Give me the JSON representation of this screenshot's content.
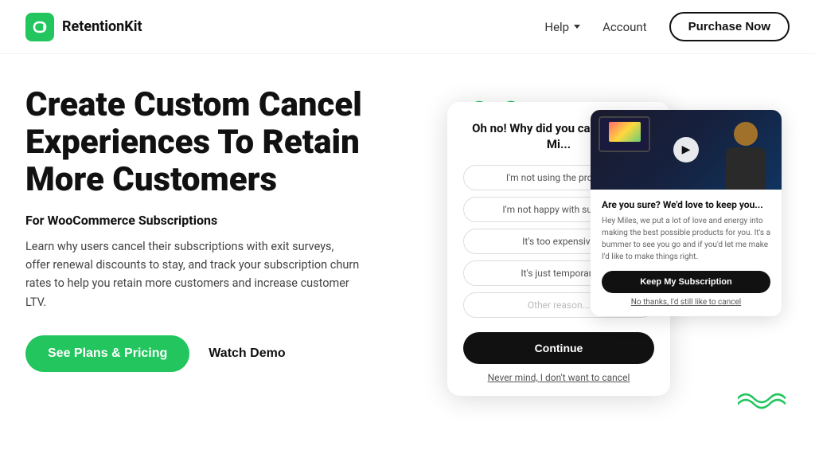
{
  "header": {
    "logo_text": "RetentionKit",
    "nav": {
      "help_label": "Help",
      "account_label": "Account",
      "purchase_label": "Purchase Now"
    }
  },
  "hero": {
    "title": "Create Custom Cancel Experiences To Retain More Customers",
    "subtitle": "For WooCommerce Subscriptions",
    "description": "Learn why users cancel their subscriptions with exit surveys, offer renewal discounts to stay, and track your subscription churn rates to help you retain more customers and increase customer LTV.",
    "cta_primary": "See Plans & Pricing",
    "cta_secondary": "Watch Demo"
  },
  "modal": {
    "header": "Oh no! Why did you cancel today Mi...",
    "options": [
      "I'm not using the product",
      "I'm not happy with support",
      "It's too expensive",
      "It's just temporary"
    ],
    "other_reason": "Other reason...",
    "continue_btn": "Continue",
    "never_mind": "Never mind, I don't want to cancel"
  },
  "retention": {
    "title": "Are you sure? We'd love to keep you...",
    "body": "Hey Miles, we put a lot of love and energy into making the best possible products for you. It's a bummer to see you go and if you'd let me make I'd like to make things right.",
    "keep_btn": "Keep My Subscription",
    "no_thanks": "No thanks, I'd still like to cancel"
  },
  "icons": {
    "logo": "↺",
    "play": "▶",
    "chevron": "∨"
  }
}
